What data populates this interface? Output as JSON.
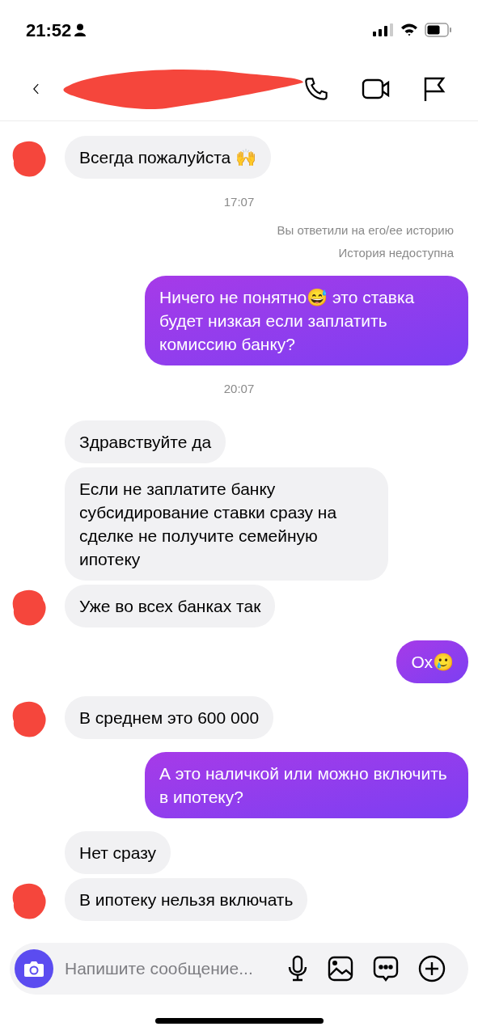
{
  "status_bar": {
    "time": "21:52"
  },
  "messages": [
    {
      "kind": "received",
      "text": "Всегда пожалуйста 🙌",
      "avatar": true
    },
    {
      "kind": "time",
      "text": "17:07"
    },
    {
      "kind": "note",
      "text": "Вы ответили на его/ее историю"
    },
    {
      "kind": "note",
      "text": "История недоступна"
    },
    {
      "kind": "sent",
      "text": "Ничего не понятно😅 это ставка будет низкая если заплатить комиссию банку?"
    },
    {
      "kind": "time",
      "text": "20:07"
    },
    {
      "kind": "received",
      "text": "Здравствуйте да",
      "avatar": false
    },
    {
      "kind": "received",
      "text": "Если не заплатите банку субсидирование ставки сразу на сделке не получите семейную ипотеку",
      "avatar": false
    },
    {
      "kind": "received",
      "text": "Уже во всех банках так",
      "avatar": true
    },
    {
      "kind": "sent",
      "text": "Ох🥲"
    },
    {
      "kind": "received",
      "text": "В среднем это 600 000",
      "avatar": true
    },
    {
      "kind": "sent",
      "text": "А это наличкой или можно включить в ипотеку?"
    },
    {
      "kind": "received",
      "text": "Нет сразу",
      "avatar": false
    },
    {
      "kind": "received",
      "text": "В ипотеку нельзя включать",
      "avatar": true
    }
  ],
  "composer": {
    "placeholder": "Напишите сообщение..."
  }
}
